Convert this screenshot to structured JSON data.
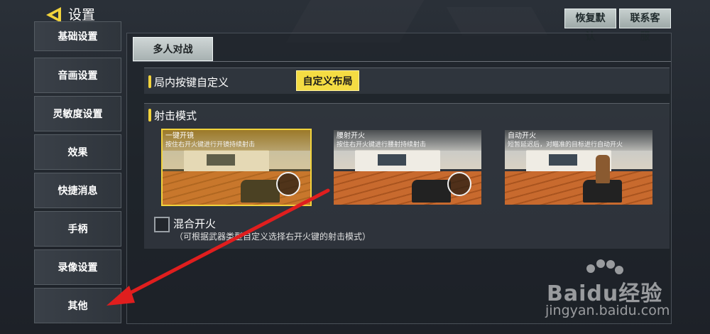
{
  "header": {
    "title": "设置",
    "restore_default": "恢复默认",
    "contact_service": "联系客服"
  },
  "sidebar": {
    "items": [
      {
        "label": "基础设置"
      },
      {
        "label": "音画设置"
      },
      {
        "label": "灵敏度设置"
      },
      {
        "label": "效果"
      },
      {
        "label": "快捷消息"
      },
      {
        "label": "手柄"
      },
      {
        "label": "录像设置"
      },
      {
        "label": "其他"
      }
    ]
  },
  "main": {
    "tab": "多人对战",
    "in_game_keys": {
      "title": "局内按键自定义",
      "button": "自定义布局"
    },
    "shooting_mode": {
      "title": "射击模式",
      "modes": [
        {
          "name": "一键开镜",
          "desc": "按住右开火键进行开镜持续射击",
          "selected": true
        },
        {
          "name": "腰射开火",
          "desc": "按住右开火键进行腰射持续射击",
          "selected": false
        },
        {
          "name": "自动开火",
          "desc": "短暂延迟后，对瞄准的目标进行自动开火",
          "selected": false
        }
      ]
    },
    "mixed_fire": {
      "label": "混合开火",
      "checked": false,
      "desc": "（可根据武器类型自定义选择右开火键的射击模式）"
    }
  },
  "watermark": {
    "brand": "Baidu经验",
    "url": "jingyan.baidu.com"
  },
  "colors": {
    "accent_yellow": "#f2d33c",
    "annotation_red": "#e01e1e"
  }
}
